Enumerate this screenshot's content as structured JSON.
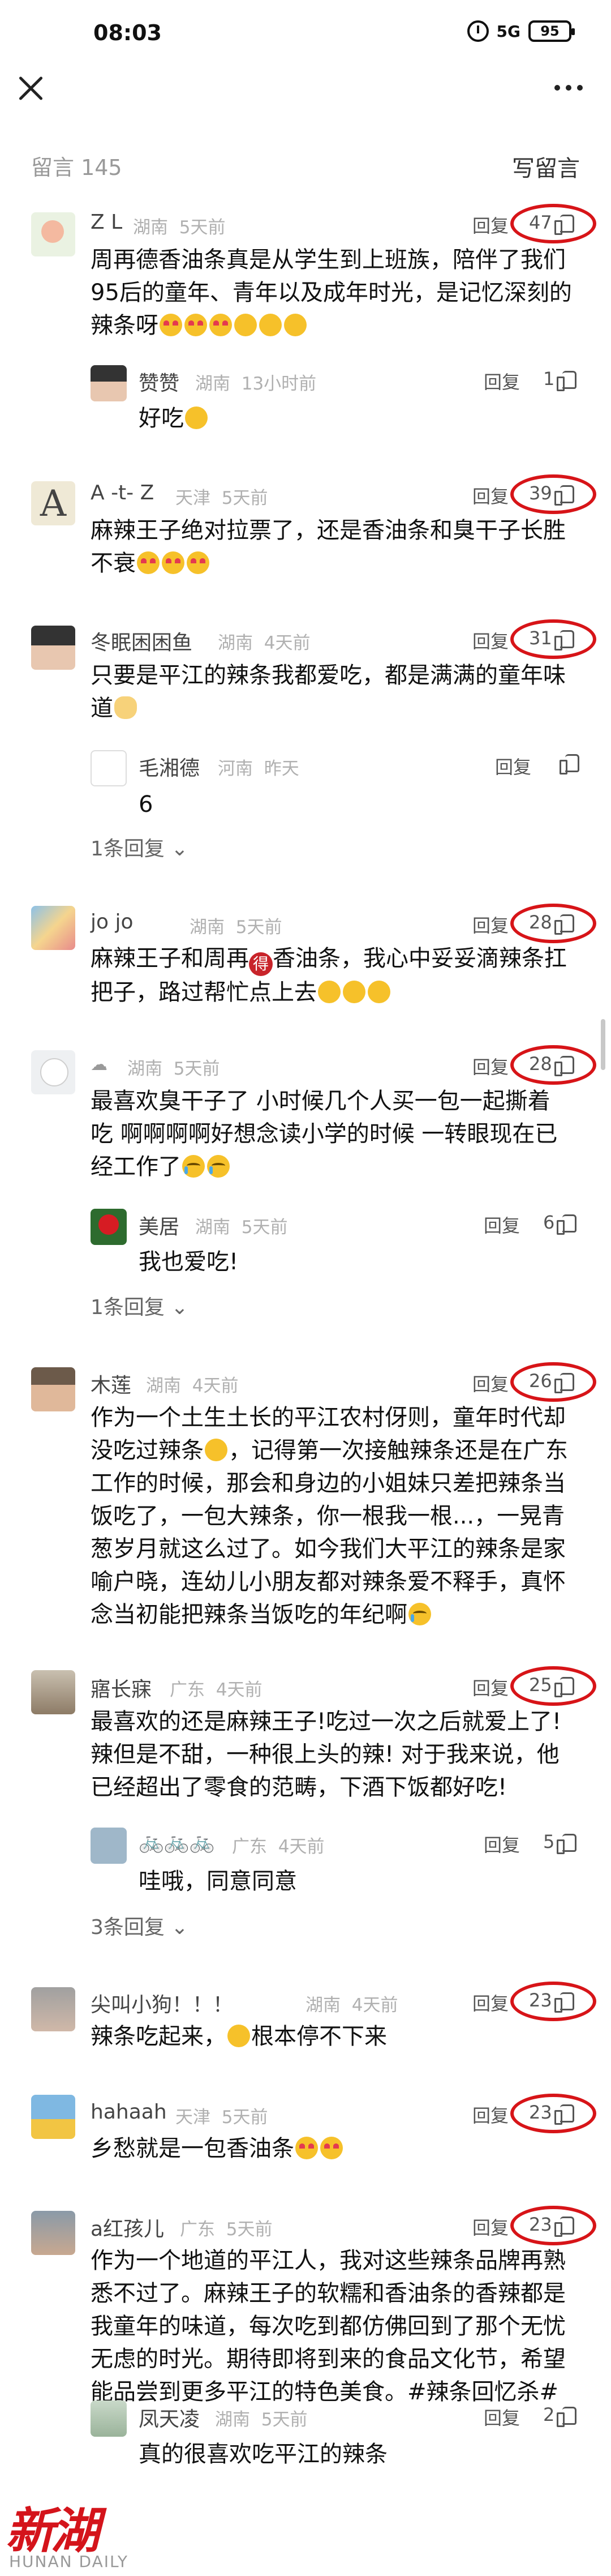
{
  "status_bar": {
    "time": "08:03",
    "signal": "5G",
    "battery": "95"
  },
  "header": {
    "count_label": "留言 145",
    "write_label": "写留言"
  },
  "reply_label": "回复",
  "comments": [
    {
      "user": "Z L",
      "location": "湖南",
      "time": "5天前",
      "likes": "47",
      "text": [
        "周再德香油条真是从学生到上班族，陪伴了我们",
        "95后的童年、青年以及成年时光，是记忆深刻的",
        "辣条呀"
      ],
      "replies": [
        {
          "user": "赞赞",
          "location": "湖南",
          "time": "13小时前",
          "likes": "1",
          "text": "好吃"
        }
      ]
    },
    {
      "user": "A -t- Z",
      "location": "天津",
      "time": "5天前",
      "likes": "39",
      "text": [
        "麻辣王子绝对拉票了，还是香油条和臭干子长胜",
        "不衰"
      ]
    },
    {
      "user": "冬眠困困鱼",
      "location": "湖南",
      "time": "4天前",
      "likes": "31",
      "text": [
        "只要是平江的辣条我都爱吃，都是满满的童年味",
        "道"
      ],
      "replies": [
        {
          "user": "毛湘德",
          "location": "河南",
          "time": "昨天",
          "likes": "",
          "text": "6"
        }
      ],
      "more": "1条回复"
    },
    {
      "user": "jo jo",
      "location": "湖南",
      "time": "5天前",
      "likes": "28",
      "text": [
        "麻辣王子和周再",
        "香油条，我心中妥妥滴辣条扛",
        "把子，路过帮忙点上去"
      ]
    },
    {
      "user": "",
      "location": "湖南",
      "time": "5天前",
      "likes": "28",
      "text": [
        "最喜欢臭干子了 小时候几个人买一包一起撕着",
        "吃 啊啊啊啊好想念读小学的时候 一转眼现在已",
        "经工作了"
      ],
      "replies": [
        {
          "user": "美居",
          "location": "湖南",
          "time": "5天前",
          "likes": "6",
          "text": "我也爱吃!"
        }
      ],
      "more": "1条回复"
    },
    {
      "user": "木莲",
      "location": "湖南",
      "time": "4天前",
      "likes": "26",
      "text": [
        "作为一个土生土长的平江农村伢则，童年时代却",
        "没吃过辣条",
        "，记得第一次接触辣条还是在广东",
        "工作的时候，那会和身边的小姐妹只差把辣条当",
        "饭吃了，一包大辣条，你一根我一根...，一晃青",
        "葱岁月就这么过了。如今我们大平江的辣条是家",
        "喻户晓，连幼儿小朋友都对辣条爱不释手，真怀",
        "念当初能把辣条当饭吃的年纪啊"
      ]
    },
    {
      "user": "寤长寐",
      "location": "广东",
      "time": "4天前",
      "likes": "25",
      "text": [
        "最喜欢的还是麻辣王子!吃过一次之后就爱上了!",
        "辣但是不甜，一种很上头的辣! 对于我来说，他",
        "已经超出了零食的范畴，下酒下饭都好吃!"
      ],
      "replies": [
        {
          "user": "",
          "location": "广东",
          "time": "4天前",
          "likes": "5",
          "text": "哇哦，同意同意"
        }
      ],
      "more": "3条回复"
    },
    {
      "user": "尖叫小狗！！！",
      "location": "湖南",
      "time": "4天前",
      "likes": "23",
      "text": [
        "辣条吃起来，",
        "根本停不下来"
      ]
    },
    {
      "user": "hahaah",
      "location": "天津",
      "time": "5天前",
      "likes": "23",
      "text": [
        "乡愁就是一包香油条"
      ]
    },
    {
      "user": "a红孩儿",
      "location": "广东",
      "time": "5天前",
      "likes": "23",
      "text": [
        "作为一个地道的平江人，我对这些辣条品牌再熟",
        "悉不过了。麻辣王子的软糯和香油条的香辣都是",
        "我童年的味道，每次吃到都仿佛回到了那个无忧",
        "无虑的时光。期待即将到来的食品文化节，希望",
        "能品尝到更多平江的特色美食。#辣条回忆杀#"
      ],
      "replies": [
        {
          "user": "凤天凌",
          "location": "湖南",
          "time": "5天前",
          "likes": "2",
          "text": "真的很喜欢吃平江的辣条"
        }
      ]
    }
  ],
  "footer": {
    "logo_text": "新湖南",
    "logo_sub": "HUNAN DAILY"
  }
}
